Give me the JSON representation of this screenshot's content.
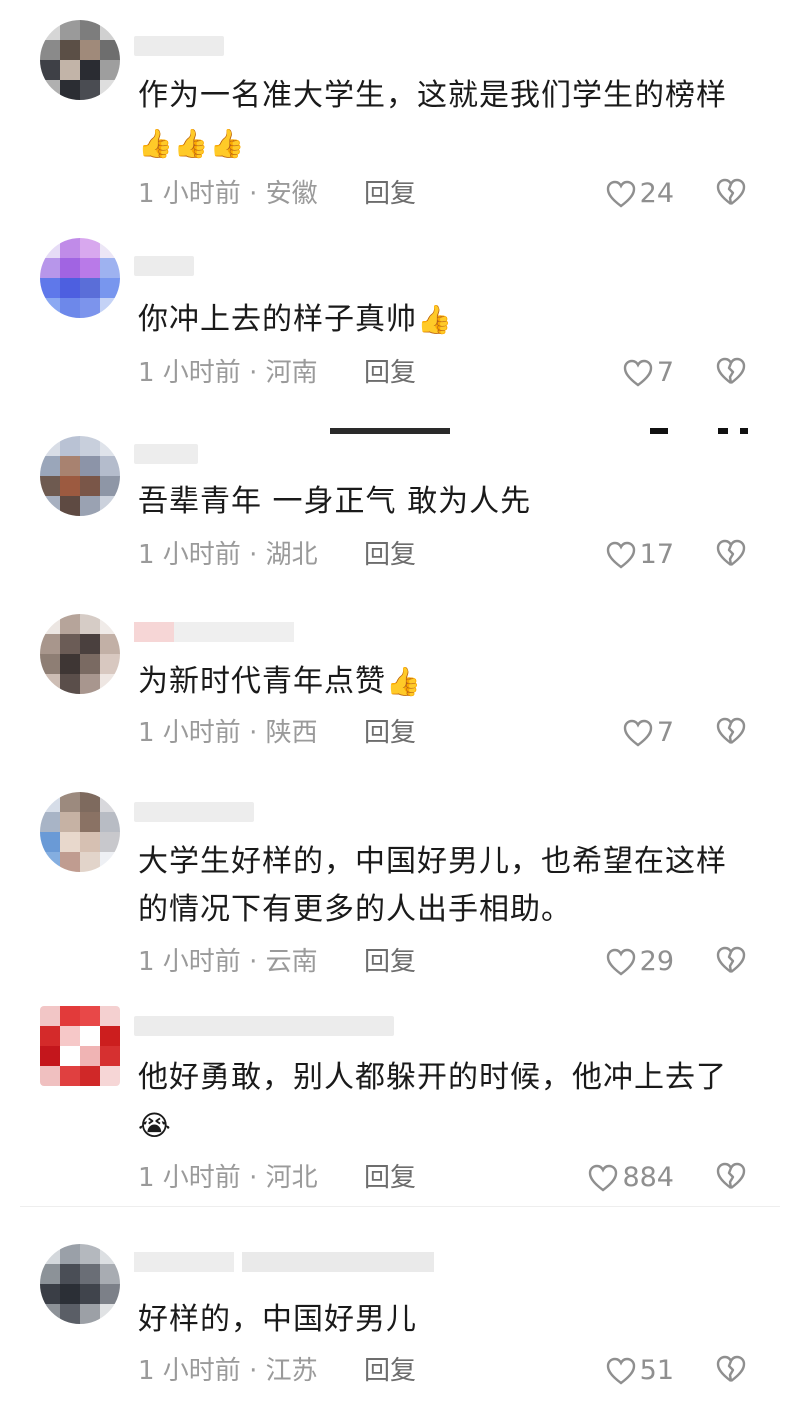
{
  "comments": [
    {
      "text": "作为一名准大学生，这就是我们学生的榜样",
      "emoji": "👍👍👍",
      "time": "1 小时前 · 安徽",
      "reply": "回复",
      "likes": "24",
      "avatar_colors": [
        "#cfcfcf",
        "#7a7068",
        "#3a3d44",
        "#6d6d6d"
      ]
    },
    {
      "text": "你冲上去的样子真帅",
      "emoji": "👍",
      "time": "1 小时前 · 河南",
      "reply": "回复",
      "likes": "7",
      "avatar_colors": [
        "#d9c7f0",
        "#a56be0",
        "#5d74e8",
        "#7ea0f0"
      ]
    },
    {
      "text": "吾辈青年 一身正气 敢为人先",
      "emoji": "",
      "time": "1 小时前 · 湖北",
      "reply": "回复",
      "likes": "17",
      "avatar_colors": [
        "#b8c4d8",
        "#9a6a5a",
        "#7a7e90",
        "#5e4a40"
      ]
    },
    {
      "text": "为新时代青年点赞",
      "emoji": "👍",
      "time": "1 小时前 · 陕西",
      "reply": "回复",
      "likes": "7",
      "avatar_colors": [
        "#e8e0da",
        "#8e7e74",
        "#4b4240",
        "#c8b2a8"
      ]
    },
    {
      "text": "大学生好样的，中国好男儿，也希望在这样的情况下有更多的人出手相助。",
      "emoji": "",
      "time": "1 小时前 · 云南",
      "reply": "回复",
      "likes": "29",
      "avatar_colors": [
        "#6fa0d8",
        "#c9b8a8",
        "#e6d8ce",
        "#8a6f60"
      ]
    },
    {
      "text": "他好勇敢，别人都躲开的时候，他冲上去了",
      "emoji": "😭",
      "time": "1 小时前 · 河北",
      "reply": "回复",
      "likes": "884",
      "avatar_colors": [
        "#e23a3a",
        "#f4c2c2",
        "#c4161c",
        "#ffffff"
      ]
    },
    {
      "text": "好样的，中国好男儿",
      "emoji": "",
      "time": "1 小时前 · 江苏",
      "reply": "回复",
      "likes": "51",
      "avatar_colors": [
        "#c8ccd0",
        "#4a4e56",
        "#2b2f36",
        "#8d9298"
      ]
    }
  ]
}
